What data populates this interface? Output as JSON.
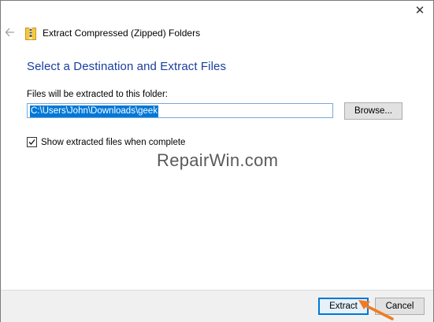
{
  "window": {
    "title": "Extract Compressed (Zipped) Folders",
    "close_icon": "close-icon",
    "back_icon": "back-arrow-icon"
  },
  "main": {
    "heading": "Select a Destination and Extract Files",
    "path_label": "Files will be extracted to this folder:",
    "path_value": "C:\\Users\\John\\Downloads\\geek",
    "browse_label": "Browse...",
    "show_files_label": "Show extracted files when complete",
    "show_files_checked": true
  },
  "watermark": "RepairWin.com",
  "footer": {
    "extract_label": "Extract",
    "cancel_label": "Cancel"
  },
  "colors": {
    "heading": "#1a3e9e",
    "selection": "#0078d7",
    "arrow": "#f07c22"
  }
}
